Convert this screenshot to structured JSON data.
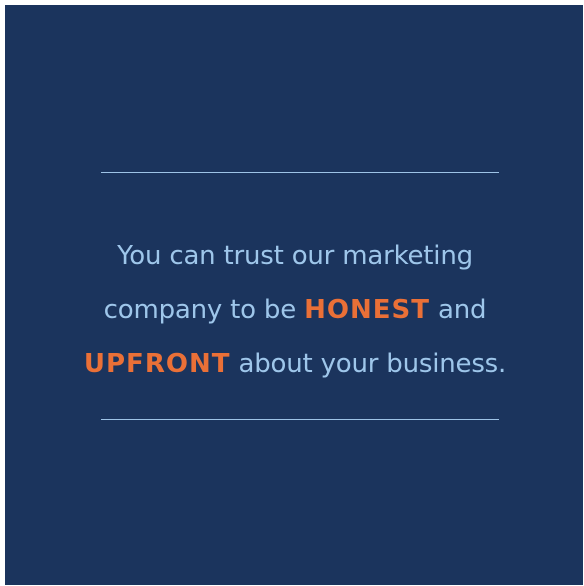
{
  "colors": {
    "background": "#1b345d",
    "text": "#9ec6ea",
    "accent": "#ea7037",
    "rule": "#9ec3e6"
  },
  "quote": {
    "line1": "You can trust our marketing",
    "line2_before": "company to be ",
    "emphasis1": "HONEST",
    "line2_after": " and",
    "emphasis2": "UPFRONT",
    "line3_after": " about your business."
  }
}
